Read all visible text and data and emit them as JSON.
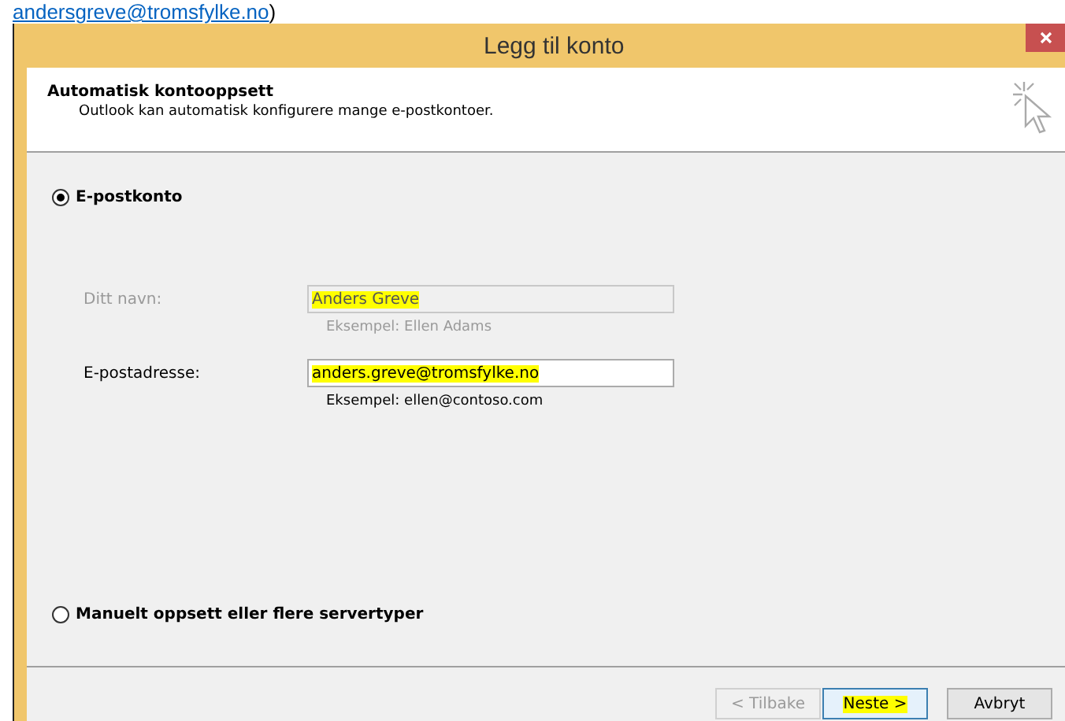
{
  "document": {
    "link": "andersgreve@tromsfylke.no",
    "trailing": ")"
  },
  "window": {
    "title": "Legg til konto"
  },
  "header": {
    "title": "Automatisk kontooppsett",
    "subtitle": "Outlook kan automatisk konfigurere mange e-postkontoer."
  },
  "options": [
    {
      "label": "E-postkonto",
      "selected": true
    },
    {
      "label": "Manuelt oppsett eller flere servertyper",
      "selected": false
    }
  ],
  "fields": [
    {
      "label": "Ditt navn:",
      "value": "Anders Greve",
      "example": "Eksempel: Ellen Adams",
      "disabled": true,
      "highlighted": true
    },
    {
      "label": "E-postadresse:",
      "value": "anders.greve@tromsfylke.no",
      "example": "Eksempel: ellen@contoso.com",
      "disabled": false,
      "highlighted": true
    }
  ],
  "buttons": [
    {
      "label": "< Tilbake",
      "disabled": true,
      "default": false,
      "highlighted": false
    },
    {
      "label": "Neste >",
      "disabled": false,
      "default": true,
      "highlighted": true
    },
    {
      "label": "Avbryt",
      "disabled": false,
      "default": false,
      "highlighted": false
    }
  ]
}
